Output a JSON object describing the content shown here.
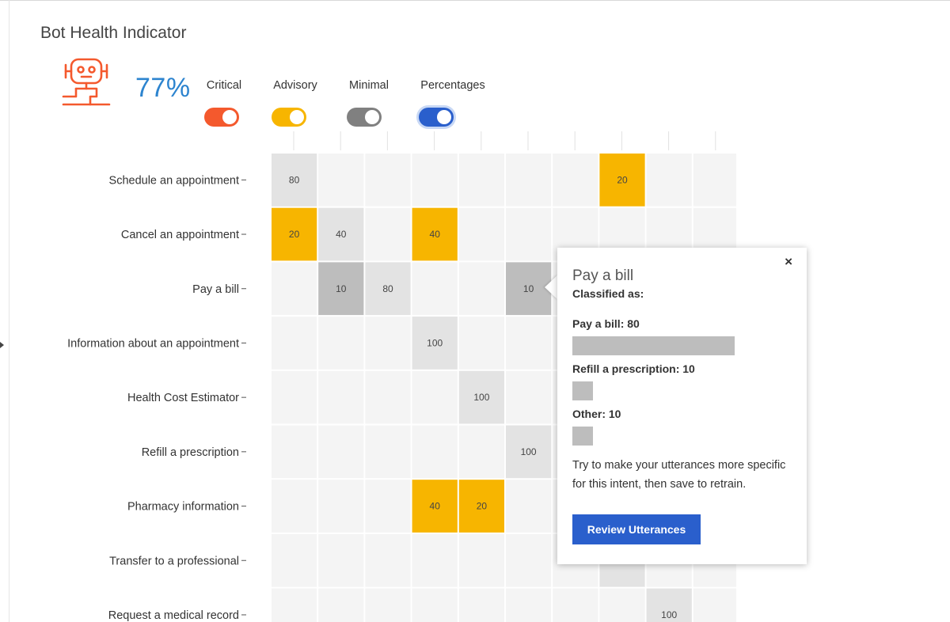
{
  "page": {
    "title": "Bot Health Indicator"
  },
  "health": {
    "value": "77%",
    "icon": "robot-icon",
    "icon_color": "#f4592d",
    "value_color": "#2d84cf"
  },
  "toggles": [
    {
      "label": "Critical",
      "color": "#f4592d",
      "on": true
    },
    {
      "label": "Advisory",
      "color": "#f7b500",
      "on": true
    },
    {
      "label": "Minimal",
      "color": "#808080",
      "on": true
    },
    {
      "label": "Percentages",
      "color": "#2a5fcc",
      "on": true,
      "selected": true
    }
  ],
  "chart_data": {
    "type": "heatmap",
    "rows": [
      "Schedule an appointment",
      "Cancel an appointment",
      "Pay a bill",
      "Information about an appointment",
      "Health Cost Estimator",
      "Refill a prescription",
      "Pharmacy information",
      "Transfer to a professional",
      "Request a medical record"
    ],
    "columns": 10,
    "level_colors": {
      "empty": "#f4f4f4",
      "light": "#e3e3e3",
      "medium": "#bdbdbd",
      "advisory": "#f7b500"
    },
    "cells": [
      {
        "row": 0,
        "col": 0,
        "value": 80,
        "level": "light"
      },
      {
        "row": 0,
        "col": 7,
        "value": 20,
        "level": "advisory"
      },
      {
        "row": 1,
        "col": 0,
        "value": 20,
        "level": "advisory"
      },
      {
        "row": 1,
        "col": 1,
        "value": 40,
        "level": "light"
      },
      {
        "row": 1,
        "col": 3,
        "value": 40,
        "level": "advisory"
      },
      {
        "row": 2,
        "col": 1,
        "value": 10,
        "level": "medium"
      },
      {
        "row": 2,
        "col": 2,
        "value": 80,
        "level": "light"
      },
      {
        "row": 2,
        "col": 5,
        "value": 10,
        "level": "medium"
      },
      {
        "row": 3,
        "col": 3,
        "value": 100,
        "level": "light"
      },
      {
        "row": 4,
        "col": 4,
        "value": 100,
        "level": "light"
      },
      {
        "row": 5,
        "col": 5,
        "value": 100,
        "level": "light"
      },
      {
        "row": 6,
        "col": 3,
        "value": 40,
        "level": "advisory"
      },
      {
        "row": 6,
        "col": 4,
        "value": 20,
        "level": "advisory"
      },
      {
        "row": 7,
        "col": 7,
        "value": null,
        "level": "light"
      },
      {
        "row": 8,
        "col": 8,
        "value": 100,
        "level": "light"
      }
    ]
  },
  "popover": {
    "title": "Pay a bill",
    "subtitle": "Classified as:",
    "close_label": "×",
    "items": [
      {
        "label": "Pay a bill: 80",
        "value": 80
      },
      {
        "label": "Refill a prescription: 10",
        "value": 10
      },
      {
        "label": "Other: 10",
        "value": 10
      }
    ],
    "hint": "Try to make your utterances more specific for this intent, then save to retrain.",
    "button_label": "Review Utterances"
  }
}
